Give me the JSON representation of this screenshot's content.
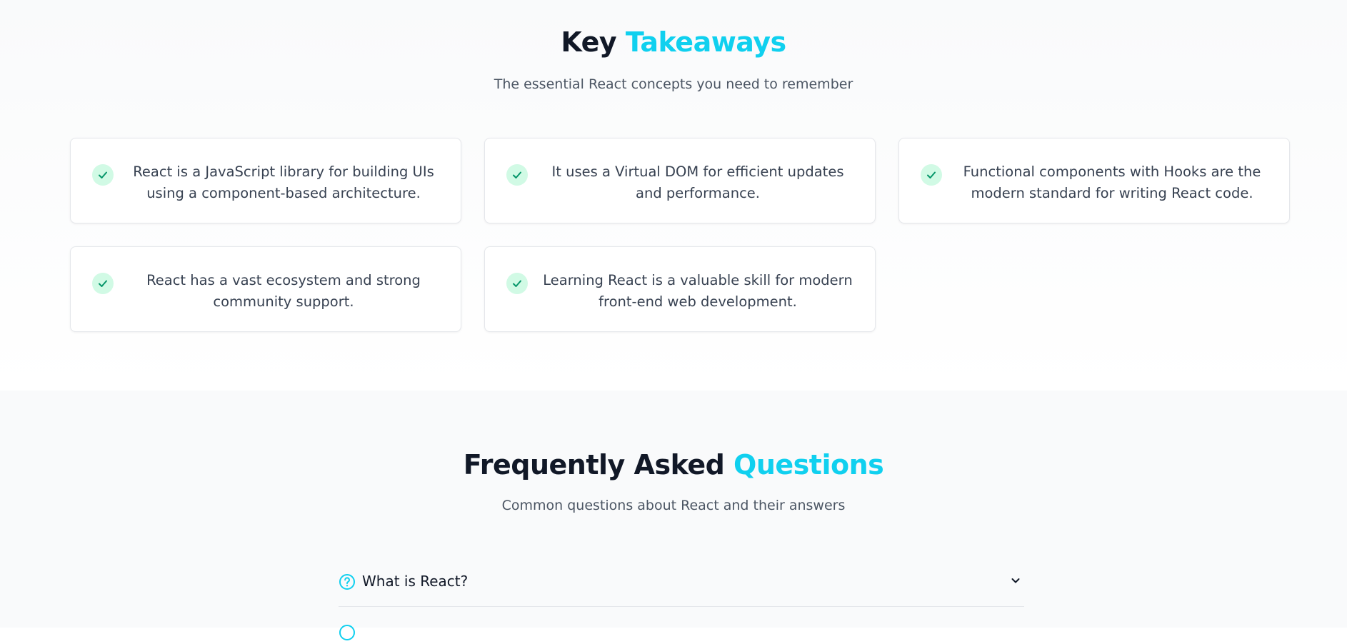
{
  "takeaways": {
    "title_prefix": "Key",
    "title_accent": "Takeaways",
    "subtitle": "The essential React concepts you need to remember",
    "items": [
      {
        "text": "React is a JavaScript library for building UIs using a component-based architecture.",
        "icon": "check-icon"
      },
      {
        "text": "It uses a Virtual DOM for efficient updates and performance.",
        "icon": "check-icon"
      },
      {
        "text": "Functional components with Hooks are the modern standard for writing React code.",
        "icon": "check-icon"
      },
      {
        "text": "React has a vast ecosystem and strong community support.",
        "icon": "check-icon"
      },
      {
        "text": "Learning React is a valuable skill for modern front-end web development.",
        "icon": "check-icon"
      }
    ]
  },
  "faq": {
    "title_prefix": "Frequently Asked",
    "title_accent": "Questions",
    "subtitle": "Common questions about React and their answers",
    "items": [
      {
        "question": "What is React?",
        "icon": "question-circle-icon",
        "expand_icon": "chevron-down-icon"
      }
    ]
  },
  "colors": {
    "accent": "#10d0ef",
    "check_bg": "#d1fae5",
    "check": "#059669",
    "text": "#111827",
    "muted": "#4b5563"
  }
}
